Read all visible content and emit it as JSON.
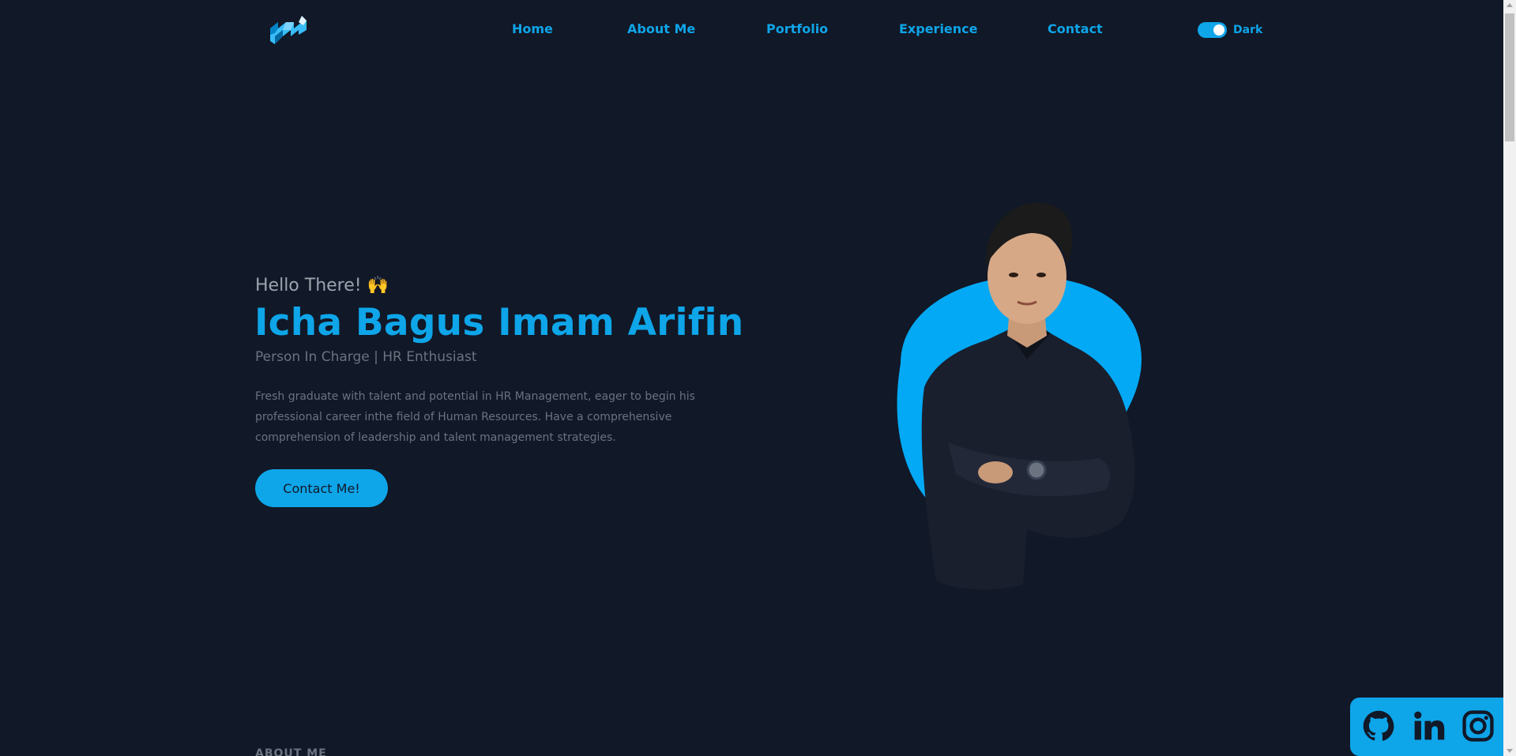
{
  "navbar": {
    "links": [
      {
        "label": "Home"
      },
      {
        "label": "About Me"
      },
      {
        "label": "Portfolio"
      },
      {
        "label": "Experience"
      },
      {
        "label": "Contact"
      }
    ],
    "theme_label": "Dark",
    "theme_on": true
  },
  "hero": {
    "greeting": "Hello There! 🙌",
    "name": "Icha Bagus Imam Arifin",
    "role": "Person In Charge | HR Enthusiast",
    "description": "Fresh graduate with talent and potential in HR Management, eager to begin his professional career inthe field of Human Resources. Have a comprehensive comprehension of leadership and talent management strategies.",
    "cta_label": "Contact Me!"
  },
  "about_peek": "ABOUT ME",
  "social": {
    "icons": [
      "github-icon",
      "linkedin-icon",
      "instagram-icon"
    ]
  },
  "colors": {
    "background": "#111827",
    "accent": "#0ea5e9",
    "muted_text": "#6b7280"
  }
}
